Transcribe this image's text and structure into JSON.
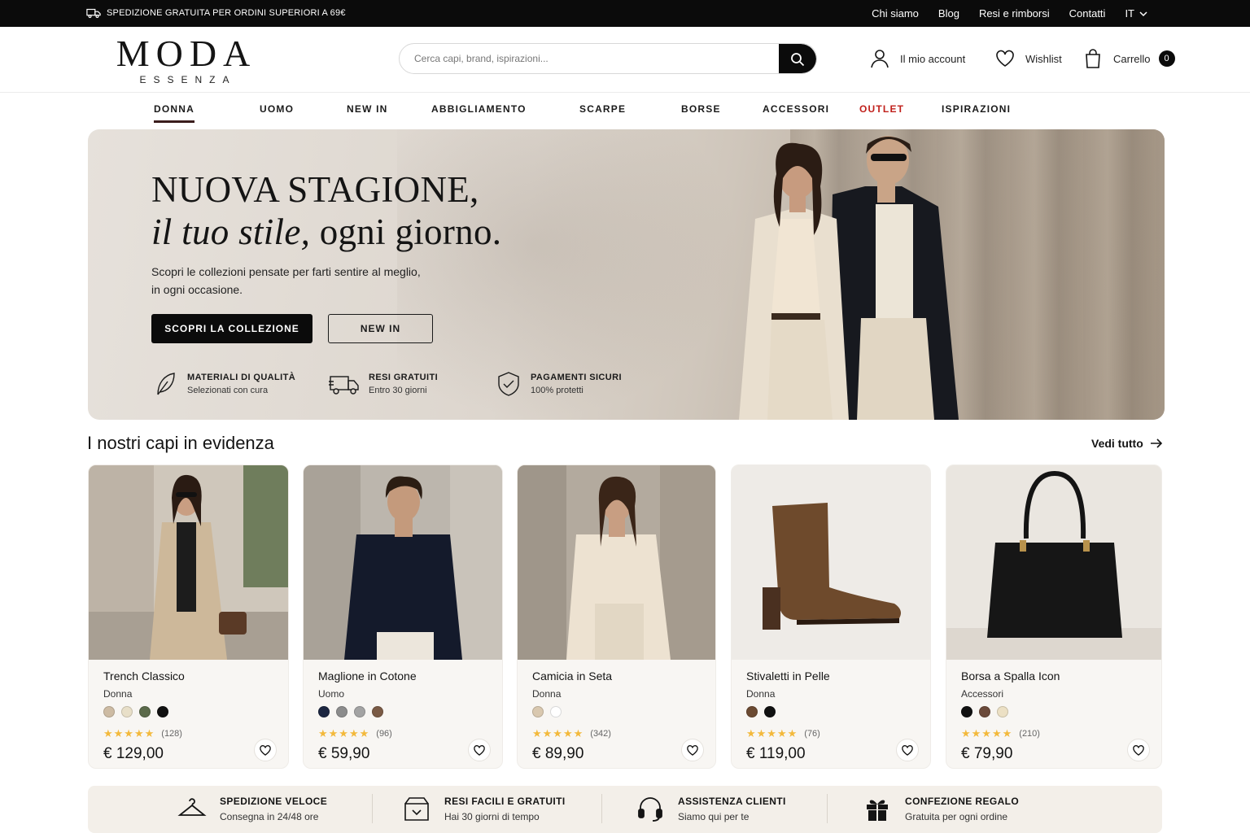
{
  "topbar": {
    "shipping_text": "SPEDIZIONE GRATUITA PER ORDINI SUPERIORI A 69€",
    "links": [
      "Chi siamo",
      "Blog",
      "Resi e rimborsi",
      "Contatti"
    ],
    "language": "IT"
  },
  "header": {
    "logo_main": "MODA",
    "logo_sub": "ESSENZA",
    "search_placeholder": "Cerca capi, brand, ispirazioni...",
    "account_label": "Il mio account",
    "wishlist_label": "Wishlist",
    "cart_label": "Carrello",
    "cart_count": "0"
  },
  "nav": {
    "items": [
      "DONNA",
      "UOMO",
      "NEW IN",
      "ABBIGLIAMENTO",
      "SCARPE",
      "BORSE",
      "ACCESSORI",
      "OUTLET",
      "ISPIRAZIONI"
    ],
    "active": "DONNA",
    "highlight_color": "#c0201b"
  },
  "hero": {
    "title_line1": "NUOVA STAGIONE,",
    "title_line2_italic": "il tuo stile,",
    "title_line2_rest": " ogni giorno.",
    "description_line1": "Scopri le collezioni pensate per farti sentire al meglio,",
    "description_line2": "in ogni occasione.",
    "cta_primary": "SCOPRI LA COLLEZIONE",
    "cta_secondary": "NEW IN",
    "features": [
      {
        "icon": "leaf-icon",
        "title": "MATERIALI DI QUALITÀ",
        "subtitle": "Selezionati con cura"
      },
      {
        "icon": "truck-icon",
        "title": "RESI GRATUITI",
        "subtitle": "Entro 30 giorni"
      },
      {
        "icon": "shield-check-icon",
        "title": "PAGAMENTI SICURI",
        "subtitle": "100% protetti"
      }
    ]
  },
  "featured": {
    "title": "I nostri capi in evidenza",
    "see_all": "Vedi tutto",
    "products": [
      {
        "name": "Trench Classico",
        "category": "Donna",
        "swatches": [
          "#cdbba3",
          "#e8dfc8",
          "#5b6a4a",
          "#111111"
        ],
        "rating_count": "(128)",
        "rating": 4.5,
        "price": "€ 129,00"
      },
      {
        "name": "Maglione in Cotone",
        "category": "Uomo",
        "swatches": [
          "#1c2640",
          "#8c8c8c",
          "#a3a3a3",
          "#7a5a45"
        ],
        "rating_count": "(96)",
        "rating": 4.5,
        "price": "€ 59,90"
      },
      {
        "name": "Camicia in Seta",
        "category": "Donna",
        "swatches": [
          "#d9c8af",
          "#ffffff"
        ],
        "rating_count": "(342)",
        "rating": 5,
        "price": "€ 89,90"
      },
      {
        "name": "Stivaletti in Pelle",
        "category": "Donna",
        "swatches": [
          "#6b4a32",
          "#111111"
        ],
        "rating_count": "(76)",
        "rating": 4.5,
        "price": "€ 119,00"
      },
      {
        "name": "Borsa a Spalla Icon",
        "category": "Accessori",
        "swatches": [
          "#111111",
          "#6b4a3a",
          "#ece0c4"
        ],
        "rating_count": "(210)",
        "rating": 4.5,
        "price": "€ 79,90"
      }
    ]
  },
  "services": [
    {
      "icon": "hanger-icon",
      "title": "SPEDIZIONE VELOCE",
      "subtitle": "Consegna in 24/48 ore"
    },
    {
      "icon": "box-return-icon",
      "title": "RESI FACILI E GRATUITI",
      "subtitle": "Hai 30 giorni di tempo"
    },
    {
      "icon": "headset-icon",
      "title": "ASSISTENZA CLIENTI",
      "subtitle": "Siamo qui per te"
    },
    {
      "icon": "gift-icon",
      "title": "CONFEZIONE REGALO",
      "subtitle": "Gratuita per ogni ordine"
    }
  ]
}
